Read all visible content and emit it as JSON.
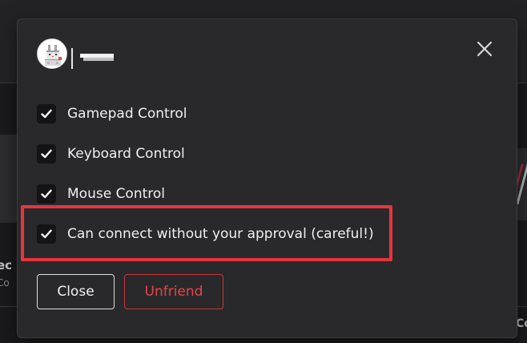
{
  "dialog": {
    "avatar_icon": "pixel-bunny-avatar-icon",
    "username": "",
    "close_icon": "close-icon",
    "options": [
      {
        "label": "Gamepad Control",
        "checked": true
      },
      {
        "label": "Keyboard Control",
        "checked": true
      },
      {
        "label": "Mouse Control",
        "checked": true
      },
      {
        "label": "Can connect without your approval (careful!)",
        "checked": true
      }
    ],
    "buttons": {
      "close_label": "Close",
      "unfriend_label": "Unfriend"
    },
    "highlight_color": "#e8343e",
    "danger_color": "#e8434a"
  },
  "background": {
    "left_text": "ec",
    "left_subtext": "Co",
    "right_text": "Co"
  }
}
